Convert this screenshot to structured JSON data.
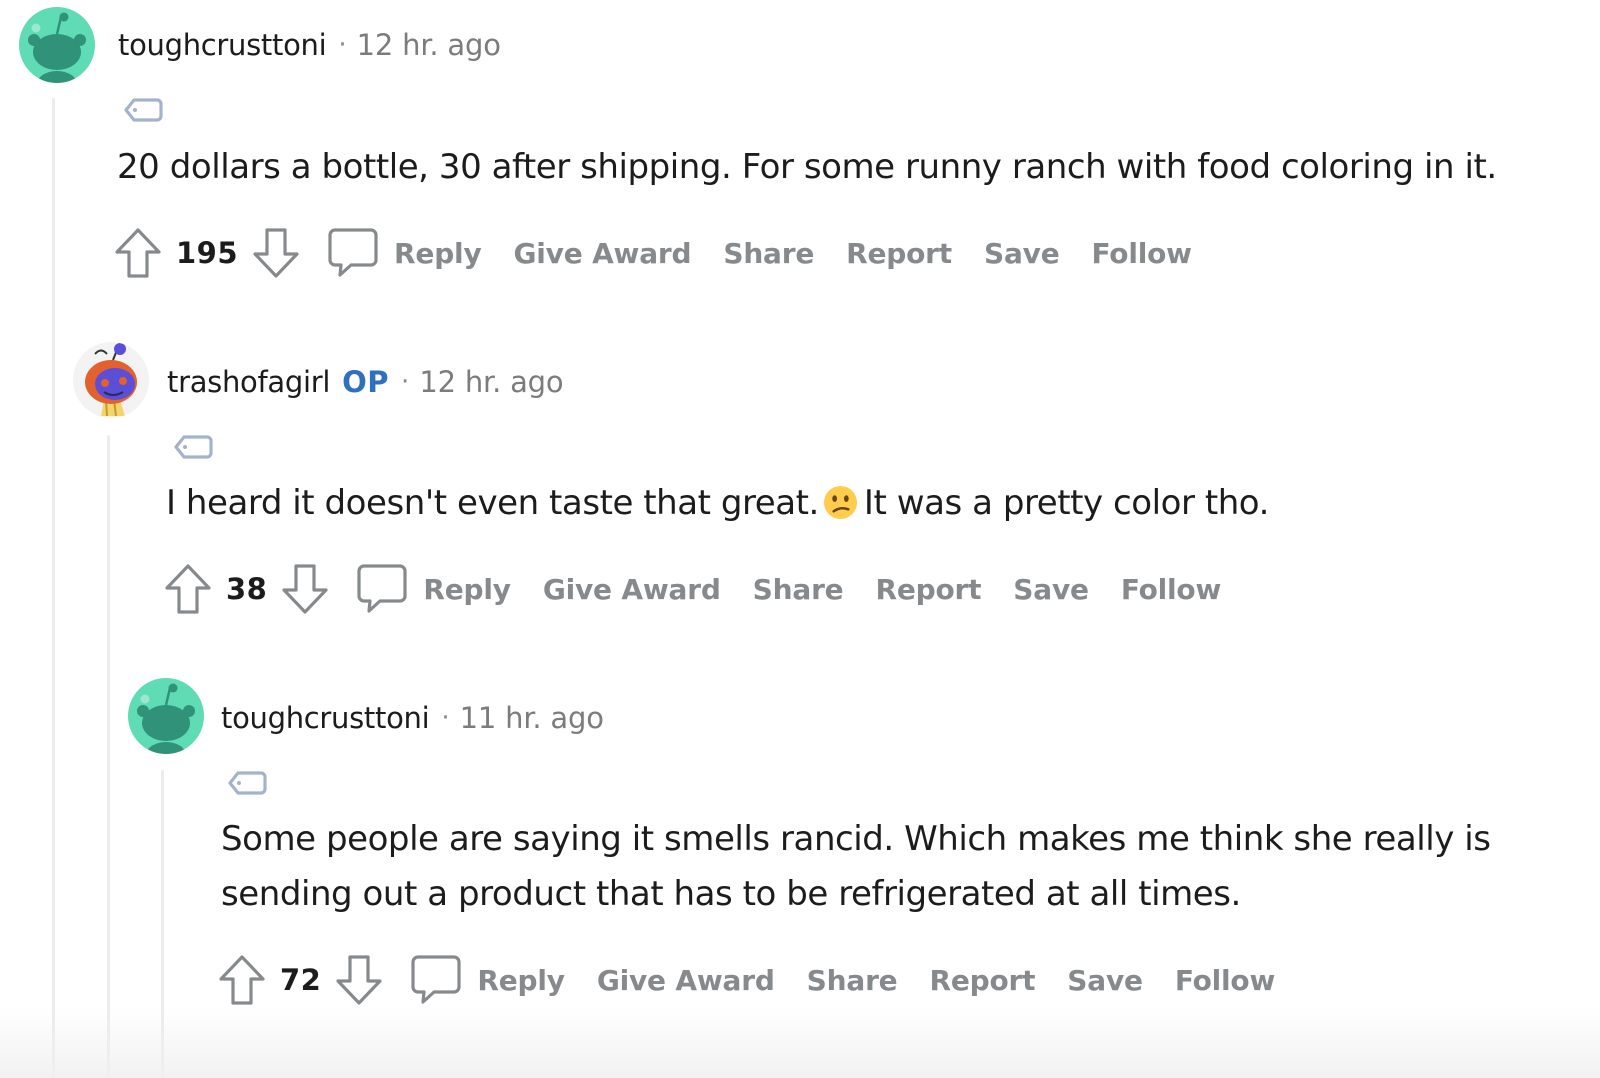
{
  "colors": {
    "username": "#1c1c1c",
    "meta": "#7c7c7c",
    "action": "#878a8c",
    "op_badge": "#2f6fbf",
    "thread_line": "#ececec",
    "avatar_teal": "#5fdcb3"
  },
  "comments": [
    {
      "username": "toughcrusttoni",
      "separator": "·",
      "time": "12 hr. ago",
      "avatar_icon": "snoo-avatar-icon",
      "text_lines": [
        "20 dollars a bottle, 30 after shipping. For some runny ranch with food coloring in it."
      ],
      "score": "195",
      "actions": {
        "reply": "Reply",
        "award": "Give Award",
        "share": "Share",
        "report": "Report",
        "save": "Save",
        "follow": "Follow"
      }
    },
    {
      "username": "trashofagirl",
      "op_badge": "OP",
      "separator": "·",
      "time": "12 hr. ago",
      "avatar_icon": "custom-snoo-avatar-icon",
      "text_before_emoji": "I heard it doesn't even taste that great.",
      "text_after_emoji": "It was a pretty color tho.",
      "emoji_icon": "confused-face-emoji",
      "score": "38",
      "actions": {
        "reply": "Reply",
        "award": "Give Award",
        "share": "Share",
        "report": "Report",
        "save": "Save",
        "follow": "Follow"
      }
    },
    {
      "username": "toughcrusttoni",
      "separator": "·",
      "time": "11 hr. ago",
      "avatar_icon": "snoo-avatar-icon",
      "text_lines": [
        "Some people are saying it smells rancid. Which makes me think she really is",
        "sending out a product that has to be refrigerated at all times."
      ],
      "score": "72",
      "actions": {
        "reply": "Reply",
        "award": "Give Award",
        "share": "Share",
        "report": "Report",
        "save": "Save",
        "follow": "Follow"
      }
    }
  ]
}
